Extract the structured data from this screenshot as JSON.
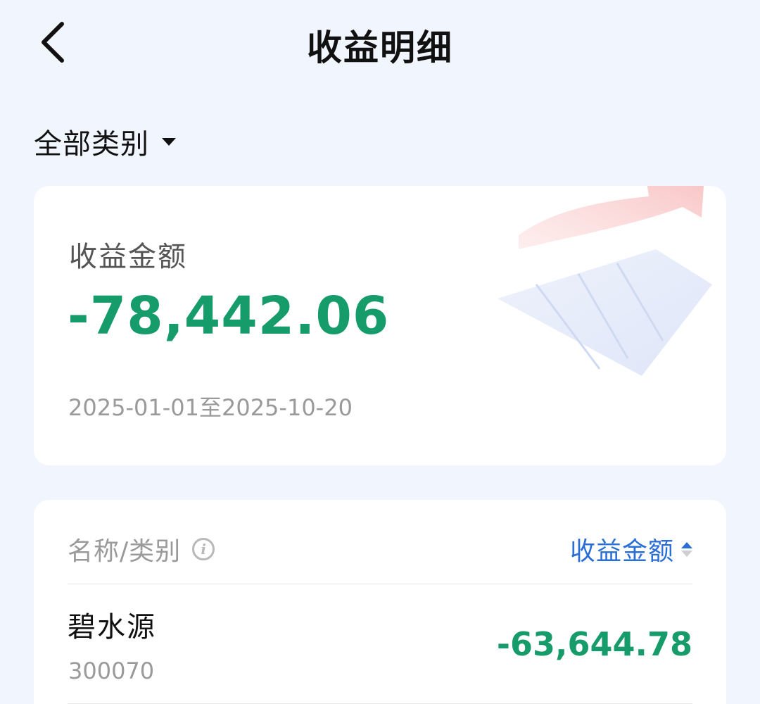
{
  "header": {
    "title": "收益明细",
    "back_icon": "chevron-left-icon"
  },
  "filter": {
    "label": "全部类别",
    "caret_icon": "caret-down-icon"
  },
  "summary": {
    "label": "收益金额",
    "amount": "-78,442.06",
    "date_range": "2025-01-01至2025-10-20",
    "amount_color": "#169b6b"
  },
  "list": {
    "col_name_label": "名称/类别",
    "col_amount_label": "收益金额",
    "info_icon": "info-icon",
    "sort_icon": "sort-icon",
    "accent_color": "#2a6fd6",
    "rows": [
      {
        "name": "碧水源",
        "code": "300070",
        "amount": "-63,644.78"
      }
    ]
  }
}
